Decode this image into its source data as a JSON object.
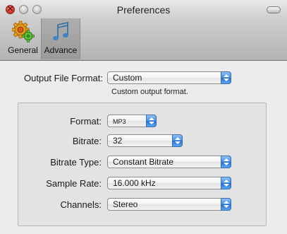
{
  "window": {
    "title": "Preferences"
  },
  "toolbar": {
    "items": [
      {
        "label": "General",
        "icon": "gears-icon",
        "selected": false
      },
      {
        "label": "Advance",
        "icon": "music-note-icon",
        "selected": true
      }
    ]
  },
  "output": {
    "label": "Output File Format:",
    "value": "Custom",
    "hint": "Custom output format."
  },
  "settings": {
    "format": {
      "label": "Format:",
      "value": "MP3"
    },
    "bitrate": {
      "label": "Bitrate:",
      "value": "32"
    },
    "bitrate_type": {
      "label": "Bitrate Type:",
      "value": "Constant Bitrate"
    },
    "sample_rate": {
      "label": "Sample Rate:",
      "value": "16.000 kHz"
    },
    "channels": {
      "label": "Channels:",
      "value": "Stereo"
    }
  },
  "colors": {
    "accent": "#3f8ee8",
    "close": "#e0443a"
  }
}
